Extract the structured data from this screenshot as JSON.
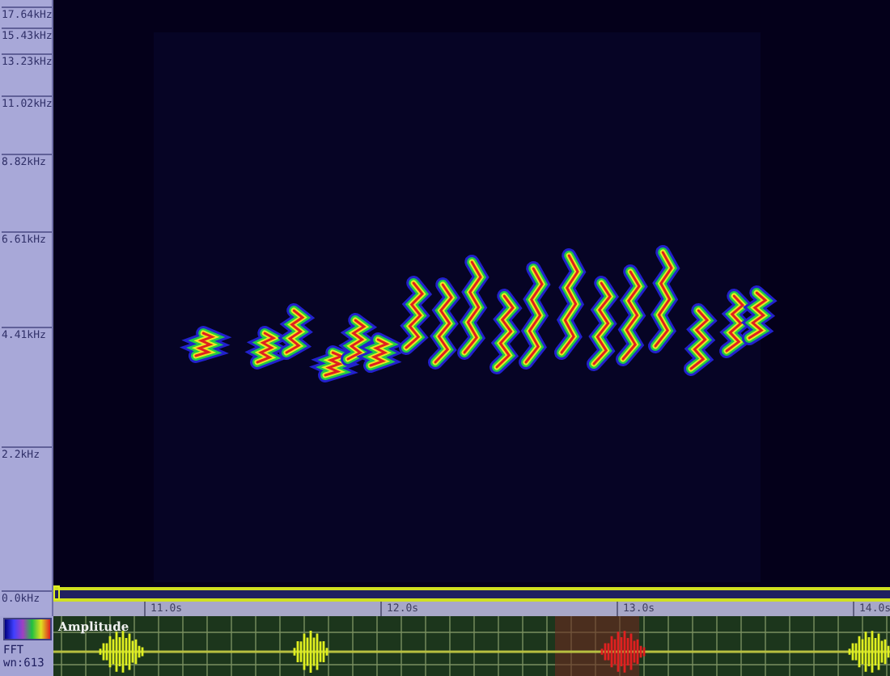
{
  "frequency_axis": {
    "labels": [
      "17.64kHz",
      "15.43kHz",
      "13.23kHz",
      "11.02kHz",
      "8.82kHz",
      "6.61kHz",
      "4.41kHz",
      "2.2kHz",
      "0.0kHz"
    ]
  },
  "time_axis": {
    "labels": [
      "11.0s",
      "12.0s",
      "13.0s",
      "14.0s"
    ]
  },
  "waveform": {
    "label": "Amplitude"
  },
  "info": {
    "lines": [
      "FFT",
      "wn:613"
    ]
  }
}
